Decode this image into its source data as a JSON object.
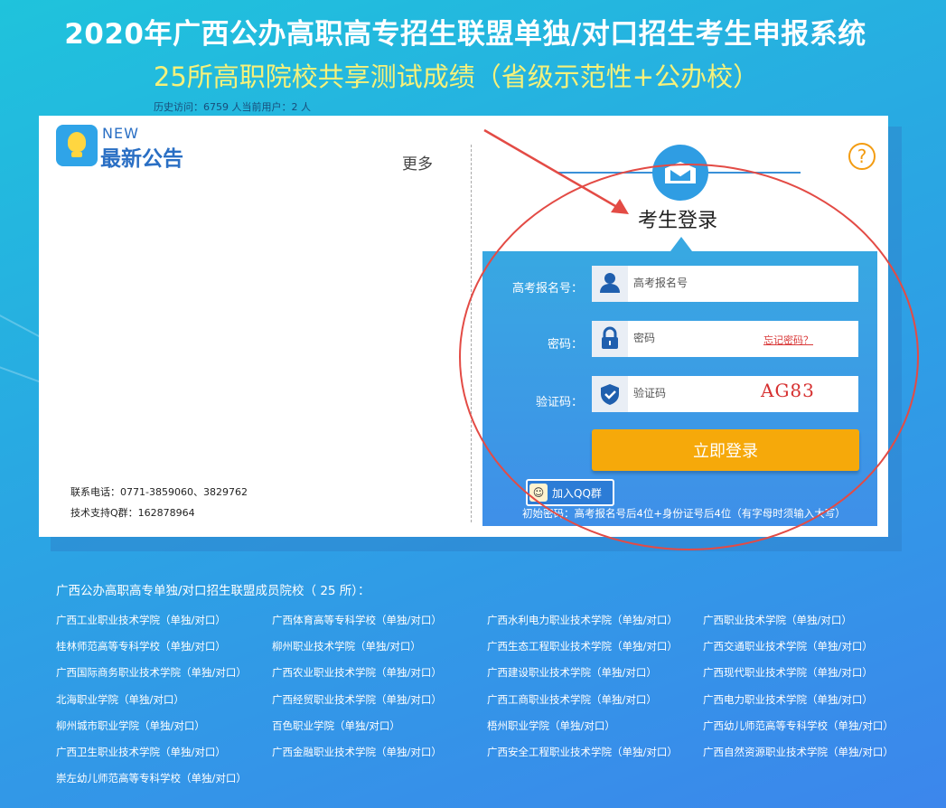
{
  "header": {
    "title": "2020年广西公办高职高专招生联盟单独/对口招生考生申报系统",
    "subtitle": "25所高职院校共享测试成绩（省级示范性+公办校）",
    "visits": "历史访问：6759 人当前用户：2 人"
  },
  "notice": {
    "new_label": "NEW",
    "title": "最新公告",
    "more": "更多",
    "phone": "联系电话：0771-3859060、3829762",
    "qq_support": "技术支持Q群：162878964"
  },
  "login": {
    "help": "?",
    "title": "考生登录",
    "exam_id_label": "高考报名号：",
    "exam_id_placeholder": "高考报名号",
    "password_label": "密码：",
    "password_placeholder": "密码",
    "forgot": "忘记密码？",
    "captcha_label": "验证码：",
    "captcha_placeholder": "验证码",
    "captcha_text": "AG83",
    "submit": "立即登录",
    "qq_group": "加入QQ群",
    "initial_password_hint": "初始密码：高考报名号后4位+身份证号后4位（有字母时须输入大写）"
  },
  "schools": {
    "title": "广西公办高职高专单独/对口招生联盟成员院校（ 25 所）：",
    "items": [
      "广西工业职业技术学院（单独/对口）",
      "广西体育高等专科学校（单独/对口）",
      "广西水利电力职业技术学院（单独/对口）",
      "广西职业技术学院（单独/对口）",
      "桂林师范高等专科学校（单独/对口）",
      "柳州职业技术学院（单独/对口）",
      "广西生态工程职业技术学院（单独/对口）",
      "广西交通职业技术学院（单独/对口）",
      "广西国际商务职业技术学院（单独/对口）",
      "广西农业职业技术学院（单独/对口）",
      "广西建设职业技术学院（单独/对口）",
      "广西现代职业技术学院（单独/对口）",
      "北海职业学院（单独/对口）",
      "广西经贸职业技术学院（单独/对口）",
      "广西工商职业技术学院（单独/对口）",
      "广西电力职业技术学院（单独/对口）",
      "柳州城市职业学院（单独/对口）",
      "百色职业学院（单独/对口）",
      "梧州职业学院（单独/对口）",
      "广西幼儿师范高等专科学校（单独/对口）",
      "广西卫生职业技术学院（单独/对口）",
      "广西金融职业技术学院（单独/对口）",
      "广西安全工程职业技术学院（单独/对口）",
      "广西自然资源职业技术学院（单独/对口）",
      "崇左幼儿师范高等专科学校（单独/对口）"
    ]
  },
  "colors": {
    "accent": "#2f9de3",
    "button": "#f6a90a",
    "subtitle": "#f6f17a",
    "annotation": "#e34b45"
  }
}
